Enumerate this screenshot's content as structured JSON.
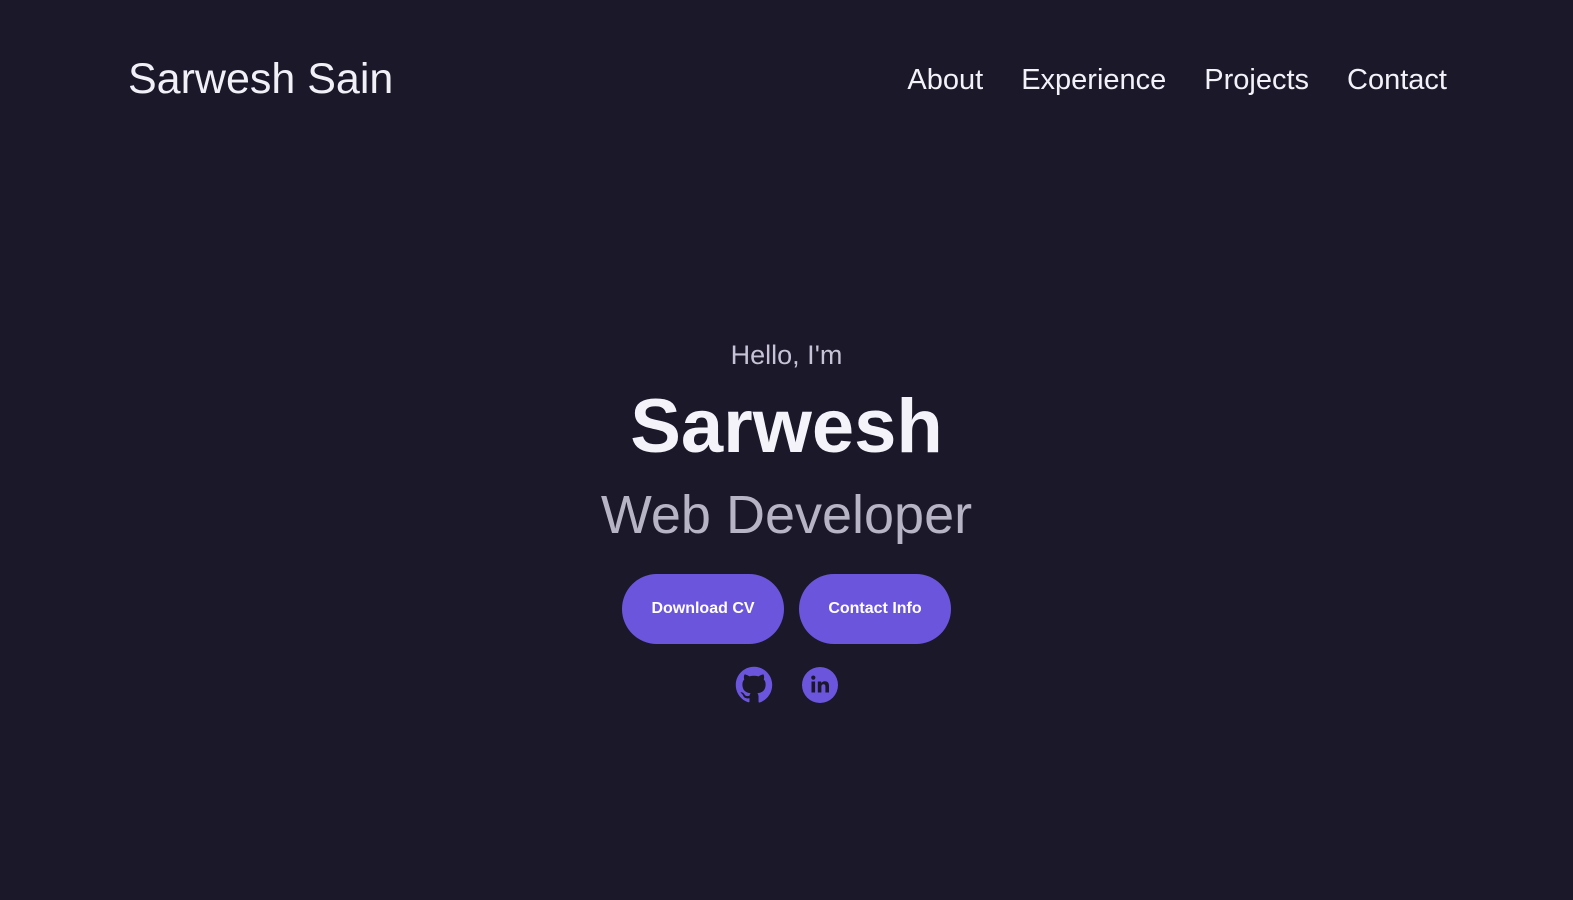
{
  "header": {
    "brand": "Sarwesh Sain",
    "nav": [
      "About",
      "Experience",
      "Projects",
      "Contact"
    ]
  },
  "hero": {
    "greeting": "Hello, I'm",
    "name": "Sarwesh",
    "role": "Web Developer",
    "buttons": {
      "download_cv": "Download CV",
      "contact_info": "Contact Info"
    },
    "socials": [
      "github-icon",
      "linkedin-icon"
    ]
  },
  "colors": {
    "background": "#1b1829",
    "accent": "#6c55dd",
    "text": "#f1f0f7",
    "muted_text": "#b7b4c5"
  }
}
